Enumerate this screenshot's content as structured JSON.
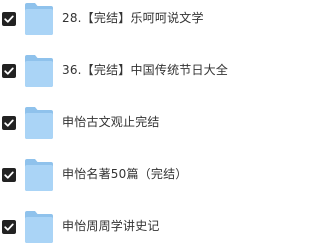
{
  "files": [
    {
      "name": "28.【完结】乐呵呵说文学",
      "checked": true,
      "icon": "folder-icon"
    },
    {
      "name": "36.【完结】中国传统节日大全",
      "checked": true,
      "icon": "folder-icon"
    },
    {
      "name": "申怡古文观止完结",
      "checked": true,
      "icon": "folder-icon"
    },
    {
      "name": "申怡名著50篇（完结）",
      "checked": true,
      "icon": "folder-icon"
    },
    {
      "name": "申怡周周学讲史记",
      "checked": true,
      "icon": "folder-icon"
    }
  ],
  "colors": {
    "checkbox": "#222222",
    "folder_back": "#8fc2ec",
    "folder_front": "#aad4f6",
    "text": "#333333"
  }
}
